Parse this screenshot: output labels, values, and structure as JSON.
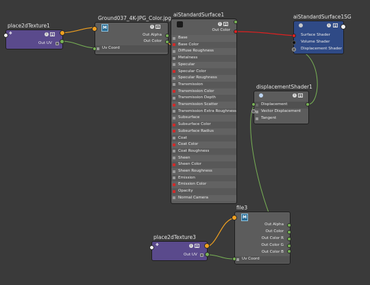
{
  "nodes": {
    "place2dTexture1": {
      "title": "place2dTexture1",
      "out_uv": "Out UV"
    },
    "ground037": {
      "title": "Ground037_4K-JPG_Color.jpg",
      "out_alpha": "Out Alpha",
      "out_color": "Out Color",
      "uv_coord": "Uv Coord",
      "icon_letter": "M"
    },
    "aiStandardSurface1": {
      "title": "aiStandardSurface1",
      "out_color": "Out Color",
      "attributes": [
        "Base",
        "Base Color",
        "Diffuse Roughness",
        "Metalness",
        "Specular",
        "Specular Color",
        "Specular Roughness",
        "Transmission",
        "Transmission Color",
        "Transmission Depth",
        "Transmission Scatter",
        "Transmission Extra Roughness",
        "Subsurface",
        "Subsurface Color",
        "Subsurface Radius",
        "Coat",
        "Coat Color",
        "Coat Roughness",
        "Sheen",
        "Sheen Color",
        "Sheen Roughness",
        "Emission",
        "Emission Color",
        "Opacity",
        "Normal Camera"
      ]
    },
    "aiStandardSurface1SG": {
      "title": "aiStandardSurface1SG",
      "surface_shader": "Surface Shader",
      "volume_shader": "Volume Shader",
      "displacement_shader": "Displacement Shader"
    },
    "displacementShader1": {
      "title": "displacementShader1",
      "displacement": "Displacement",
      "vector_displacement": "Vector Displacement",
      "tangent": "Tangent"
    },
    "file3": {
      "title": "file3",
      "out_alpha": "Out Alpha",
      "out_color": "Out Color",
      "out_color_r": "Out Color R",
      "out_color_g": "Out Color G",
      "out_color_b": "Out Color B",
      "uv_coord": "Uv Coord",
      "icon_letter": "M"
    },
    "place2dTexture3": {
      "title": "place2dTexture3",
      "out_uv": "Out UV"
    }
  },
  "icons": {
    "node_info": "info-icon",
    "node_list": "list-icon"
  },
  "colors": {
    "background": "#3a3a3a",
    "grey_node": "#5c5c5c",
    "place2d_node": "#5a4a8c",
    "shading_group_node": "#2f4a86",
    "green_wire": "#78b255",
    "orange_wire": "#f0a020",
    "red_wire": "#e02020"
  }
}
